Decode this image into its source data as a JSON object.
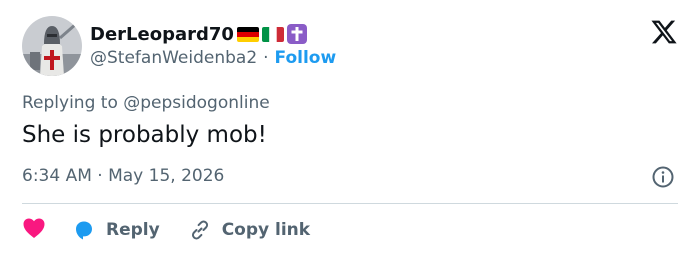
{
  "tweet": {
    "author": {
      "display_name": "DerLeopard70",
      "handle": "@StefanWeidenba2",
      "badges": [
        "germany-flag",
        "italy-flag",
        "latin-cross-emoji"
      ]
    },
    "follow_label": "Follow",
    "separator": "·",
    "replying_to": "Replying to @pepsidogonline",
    "text": "She is probably mob!",
    "timestamp": "6:34 AM · May 15, 2026"
  },
  "actions": {
    "like_icon": "heart-icon",
    "reply_label": "Reply",
    "copy_link_label": "Copy link"
  },
  "colors": {
    "accent": "#1d9bf0",
    "like": "#f91880",
    "secondary_text": "#536471",
    "primary_text": "#0f1419",
    "divider": "#cfd9de"
  }
}
